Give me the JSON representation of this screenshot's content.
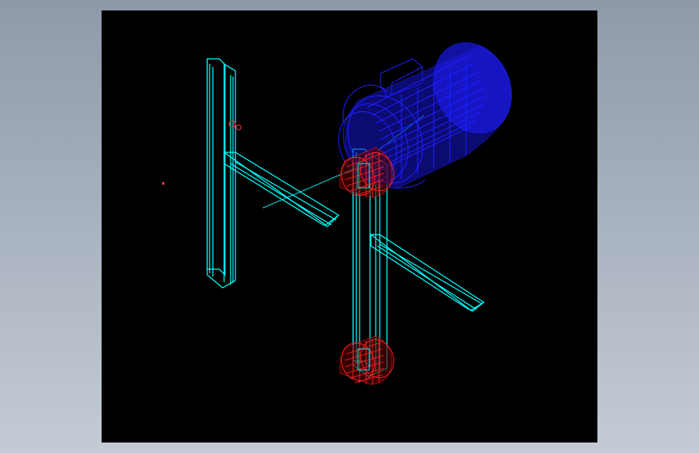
{
  "window": {
    "background_color": "#9ca6b4",
    "viewport_background": "#000000"
  },
  "drawing": {
    "colors": {
      "frame": "#00ffff",
      "motor": "#1f1fff",
      "bearings": "#ff2020",
      "axis_line": "#00e5e5",
      "marker": "#ff3030"
    }
  }
}
